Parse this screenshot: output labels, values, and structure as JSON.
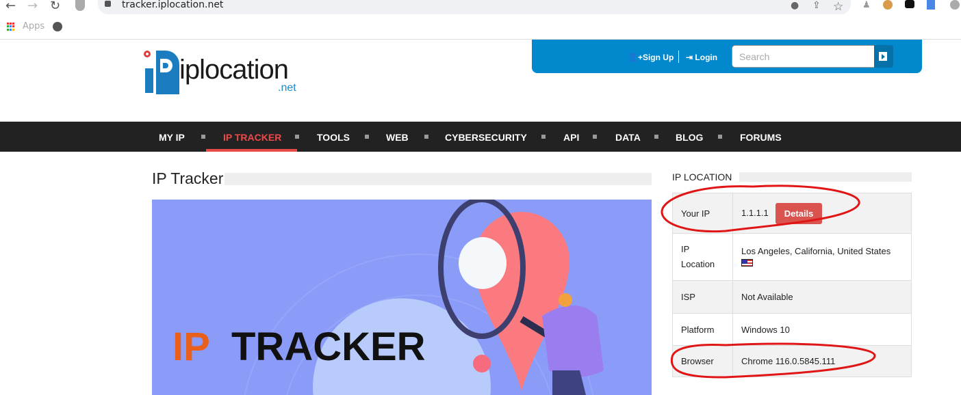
{
  "browser": {
    "url": "tracker.iplocation.net",
    "bookmarks": {
      "apps_label": "Apps"
    }
  },
  "header": {
    "logo_text": "iplocation",
    "logo_suffix": ".net",
    "signup_label": "Sign Up",
    "login_label": "Login",
    "search_placeholder": "Search",
    "accent_color": "#0288cc"
  },
  "nav": {
    "items": [
      {
        "label": "MY IP"
      },
      {
        "label": "IP TRACKER",
        "active": true
      },
      {
        "label": "TOOLS"
      },
      {
        "label": "WEB"
      },
      {
        "label": "CYBERSECURITY"
      },
      {
        "label": "API"
      },
      {
        "label": "DATA"
      },
      {
        "label": "BLOG"
      },
      {
        "label": "FORUMS"
      }
    ],
    "active_color": "#e84a4a"
  },
  "main": {
    "title": "IP Tracker",
    "banner": {
      "word1": "IP",
      "word2": "TRACKER"
    }
  },
  "sidebar": {
    "title": "IP LOCATION",
    "rows": [
      {
        "label": "Your IP",
        "value": "1.1.1.1",
        "button": "Details"
      },
      {
        "label": "IP Location",
        "value": "Los Angeles, California, United States"
      },
      {
        "label": "ISP",
        "value": "Not Available"
      },
      {
        "label": "Platform",
        "value": "Windows 10"
      },
      {
        "label": "Browser",
        "value": "Chrome 116.0.5845.111"
      }
    ]
  }
}
